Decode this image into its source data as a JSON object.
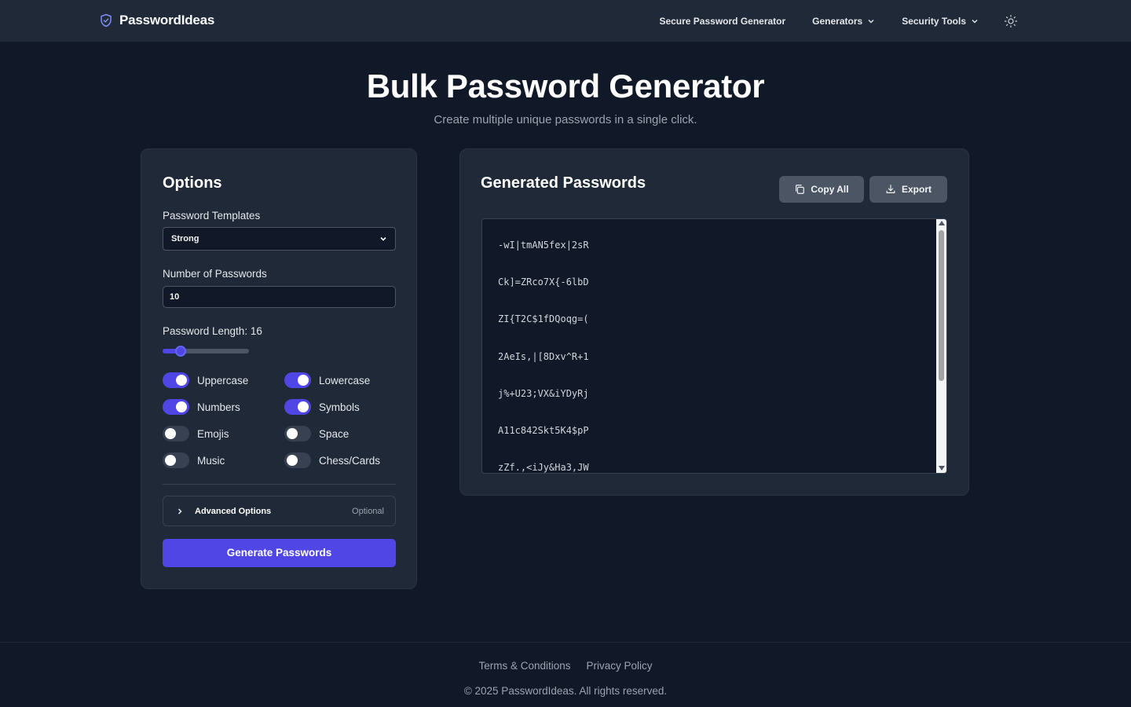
{
  "header": {
    "brand_name": "PasswordIdeas",
    "nav": [
      {
        "label": "Secure Password Generator",
        "dropdown": false
      },
      {
        "label": "Generators",
        "dropdown": true
      },
      {
        "label": "Security Tools",
        "dropdown": true
      }
    ],
    "theme_icon": "sun-icon"
  },
  "hero": {
    "title": "Bulk Password Generator",
    "subtitle": "Create multiple unique passwords in a single click."
  },
  "options": {
    "title": "Options",
    "template_label": "Password Templates",
    "template_value": "Strong",
    "count_label": "Number of Passwords",
    "count_value": "10",
    "length_label": "Password Length: 16",
    "length_slider_fraction": 0.21,
    "toggles": [
      {
        "label": "Uppercase",
        "on": true
      },
      {
        "label": "Lowercase",
        "on": true
      },
      {
        "label": "Numbers",
        "on": true
      },
      {
        "label": "Symbols",
        "on": true
      },
      {
        "label": "Emojis",
        "on": false
      },
      {
        "label": "Space",
        "on": false
      },
      {
        "label": "Music",
        "on": false
      },
      {
        "label": "Chess/Cards",
        "on": false
      }
    ],
    "advanced_label": "Advanced Options",
    "advanced_optional": "Optional",
    "generate_label": "Generate Passwords"
  },
  "output": {
    "title": "Generated Passwords",
    "copy_label": "Copy All",
    "export_label": "Export",
    "passwords": [
      "-wI|tmAN5fex|2sR",
      "Ck]=ZRco7X{-6lbD",
      "ZI{T2C$1fDQoqg=(",
      "2AeIs,|[8Dxv^R+1",
      "j%+U23;VX&iYDyRj",
      "A11c842Skt5K4$pP",
      "zZf.,<iJy&Ha3,JW"
    ]
  },
  "footer": {
    "links": [
      "Terms & Conditions",
      "Privacy Policy"
    ],
    "copyright": "© 2025 PasswordIdeas. All rights reserved."
  },
  "colors": {
    "background": "#111827",
    "card": "#1f2937",
    "accent": "#4f46e5",
    "muted_text": "#9ca3af"
  }
}
